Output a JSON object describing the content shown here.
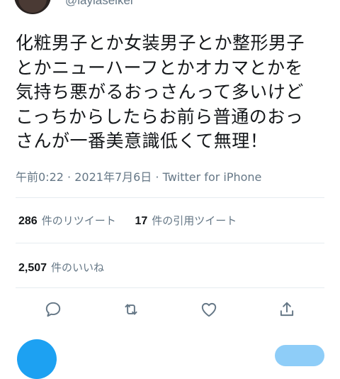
{
  "tweet": {
    "handle": "@laylaseikei",
    "lines": [
      "化粧男子とか女装男子とか整形男子",
      "とかニューハーフとかオカマとかを",
      "気持ち悪がるおっさんって多いけど",
      "こっちからしたらお前ら普通のおっ",
      "さんが一番美意識低くて無理！"
    ],
    "time": "午前0:22",
    "date": "2021年7月6日",
    "separator": "·",
    "source": "Twitter for iPhone"
  },
  "stats": {
    "retweets_count": "286",
    "retweets_label": "件のリツイート",
    "quotes_count": "17",
    "quotes_label": "件の引用ツイート",
    "likes_count": "2,507",
    "likes_label": "件のいいね"
  },
  "actions": [
    "reply-icon",
    "retweet-icon",
    "like-icon",
    "share-icon"
  ],
  "colors": {
    "accent": "#1da1f2",
    "muted": "#657786",
    "text": "#14171a",
    "divider": "#e6ecf0"
  }
}
